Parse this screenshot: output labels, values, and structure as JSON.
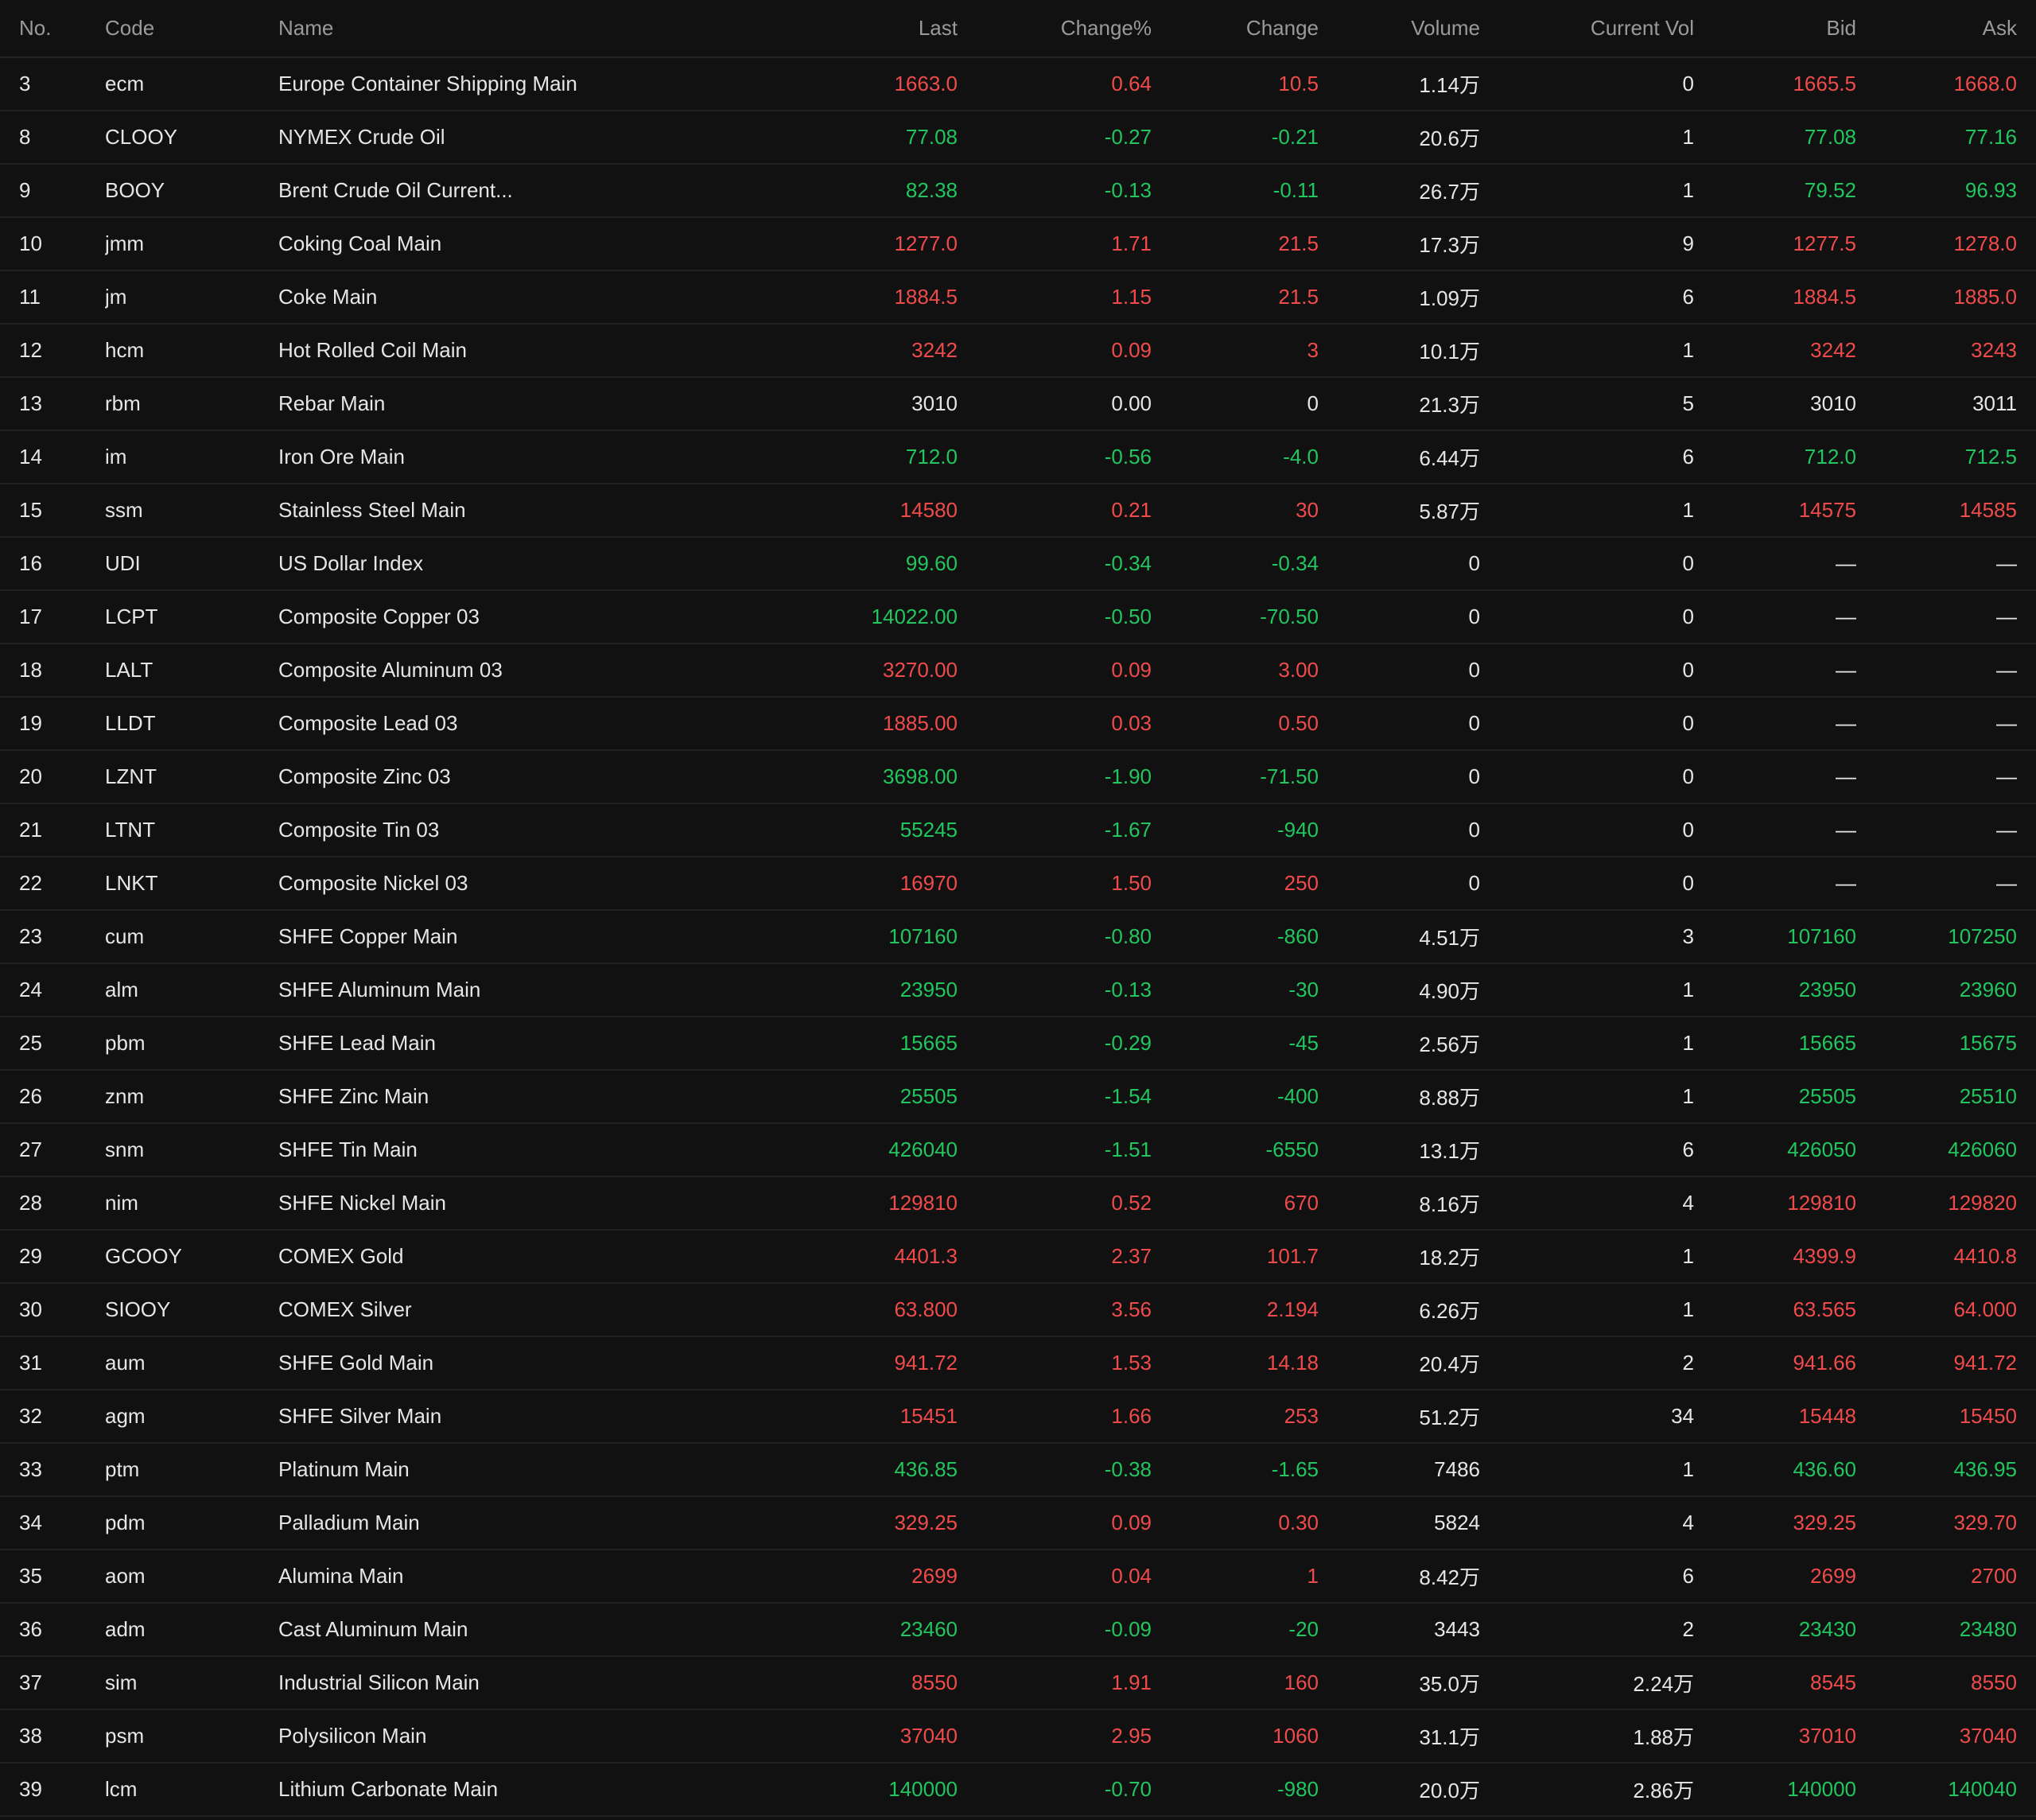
{
  "colors": {
    "background": "#111111",
    "up": "#f04b4b",
    "down": "#22c55e",
    "flat": "#e6e6e6",
    "header_text": "#9a9a9a"
  },
  "table": {
    "headers": {
      "no": "No.",
      "code": "Code",
      "name": "Name",
      "last": "Last",
      "change_pct": "Change%",
      "change": "Change",
      "volume": "Volume",
      "current_vol": "Current Vol",
      "bid": "Bid",
      "ask": "Ask"
    },
    "rows": [
      {
        "no": "3",
        "code": "ecm",
        "name": "Europe Container Shipping Main",
        "last": "1663.0",
        "change_pct": "0.64",
        "change": "10.5",
        "volume": "1.14万",
        "current_vol": "0",
        "bid": "1665.5",
        "ask": "1668.0",
        "dir": "up"
      },
      {
        "no": "8",
        "code": "CLOOY",
        "name": "NYMEX Crude Oil",
        "last": "77.08",
        "change_pct": "-0.27",
        "change": "-0.21",
        "volume": "20.6万",
        "current_vol": "1",
        "bid": "77.08",
        "ask": "77.16",
        "dir": "down"
      },
      {
        "no": "9",
        "code": "BOOY",
        "name": "Brent Crude Oil Current...",
        "last": "82.38",
        "change_pct": "-0.13",
        "change": "-0.11",
        "volume": "26.7万",
        "current_vol": "1",
        "bid": "79.52",
        "ask": "96.93",
        "dir": "down"
      },
      {
        "no": "10",
        "code": "jmm",
        "name": "Coking Coal Main",
        "last": "1277.0",
        "change_pct": "1.71",
        "change": "21.5",
        "volume": "17.3万",
        "current_vol": "9",
        "bid": "1277.5",
        "ask": "1278.0",
        "dir": "up"
      },
      {
        "no": "11",
        "code": "jm",
        "name": "Coke Main",
        "last": "1884.5",
        "change_pct": "1.15",
        "change": "21.5",
        "volume": "1.09万",
        "current_vol": "6",
        "bid": "1884.5",
        "ask": "1885.0",
        "dir": "up"
      },
      {
        "no": "12",
        "code": "hcm",
        "name": "Hot Rolled Coil Main",
        "last": "3242",
        "change_pct": "0.09",
        "change": "3",
        "volume": "10.1万",
        "current_vol": "1",
        "bid": "3242",
        "ask": "3243",
        "dir": "up"
      },
      {
        "no": "13",
        "code": "rbm",
        "name": "Rebar Main",
        "last": "3010",
        "change_pct": "0.00",
        "change": "0",
        "volume": "21.3万",
        "current_vol": "5",
        "bid": "3010",
        "ask": "3011",
        "dir": "flat"
      },
      {
        "no": "14",
        "code": "im",
        "name": "Iron Ore Main",
        "last": "712.0",
        "change_pct": "-0.56",
        "change": "-4.0",
        "volume": "6.44万",
        "current_vol": "6",
        "bid": "712.0",
        "ask": "712.5",
        "dir": "down"
      },
      {
        "no": "15",
        "code": "ssm",
        "name": "Stainless Steel Main",
        "last": "14580",
        "change_pct": "0.21",
        "change": "30",
        "volume": "5.87万",
        "current_vol": "1",
        "bid": "14575",
        "ask": "14585",
        "dir": "up"
      },
      {
        "no": "16",
        "code": "UDI",
        "name": "US Dollar Index",
        "last": "99.60",
        "change_pct": "-0.34",
        "change": "-0.34",
        "volume": "0",
        "current_vol": "0",
        "bid": "—",
        "ask": "—",
        "dir": "down"
      },
      {
        "no": "17",
        "code": "LCPT",
        "name": "Composite Copper 03",
        "last": "14022.00",
        "change_pct": "-0.50",
        "change": "-70.50",
        "volume": "0",
        "current_vol": "0",
        "bid": "—",
        "ask": "—",
        "dir": "down"
      },
      {
        "no": "18",
        "code": "LALT",
        "name": "Composite Aluminum 03",
        "last": "3270.00",
        "change_pct": "0.09",
        "change": "3.00",
        "volume": "0",
        "current_vol": "0",
        "bid": "—",
        "ask": "—",
        "dir": "up"
      },
      {
        "no": "19",
        "code": "LLDT",
        "name": "Composite Lead 03",
        "last": "1885.00",
        "change_pct": "0.03",
        "change": "0.50",
        "volume": "0",
        "current_vol": "0",
        "bid": "—",
        "ask": "—",
        "dir": "up"
      },
      {
        "no": "20",
        "code": "LZNT",
        "name": "Composite Zinc 03",
        "last": "3698.00",
        "change_pct": "-1.90",
        "change": "-71.50",
        "volume": "0",
        "current_vol": "0",
        "bid": "—",
        "ask": "—",
        "dir": "down"
      },
      {
        "no": "21",
        "code": "LTNT",
        "name": "Composite Tin 03",
        "last": "55245",
        "change_pct": "-1.67",
        "change": "-940",
        "volume": "0",
        "current_vol": "0",
        "bid": "—",
        "ask": "—",
        "dir": "down"
      },
      {
        "no": "22",
        "code": "LNKT",
        "name": "Composite Nickel 03",
        "last": "16970",
        "change_pct": "1.50",
        "change": "250",
        "volume": "0",
        "current_vol": "0",
        "bid": "—",
        "ask": "—",
        "dir": "up"
      },
      {
        "no": "23",
        "code": "cum",
        "name": "SHFE Copper Main",
        "last": "107160",
        "change_pct": "-0.80",
        "change": "-860",
        "volume": "4.51万",
        "current_vol": "3",
        "bid": "107160",
        "ask": "107250",
        "dir": "down"
      },
      {
        "no": "24",
        "code": "alm",
        "name": "SHFE Aluminum Main",
        "last": "23950",
        "change_pct": "-0.13",
        "change": "-30",
        "volume": "4.90万",
        "current_vol": "1",
        "bid": "23950",
        "ask": "23960",
        "dir": "down"
      },
      {
        "no": "25",
        "code": "pbm",
        "name": "SHFE Lead Main",
        "last": "15665",
        "change_pct": "-0.29",
        "change": "-45",
        "volume": "2.56万",
        "current_vol": "1",
        "bid": "15665",
        "ask": "15675",
        "dir": "down"
      },
      {
        "no": "26",
        "code": "znm",
        "name": "SHFE Zinc Main",
        "last": "25505",
        "change_pct": "-1.54",
        "change": "-400",
        "volume": "8.88万",
        "current_vol": "1",
        "bid": "25505",
        "ask": "25510",
        "dir": "down"
      },
      {
        "no": "27",
        "code": "snm",
        "name": "SHFE Tin Main",
        "last": "426040",
        "change_pct": "-1.51",
        "change": "-6550",
        "volume": "13.1万",
        "current_vol": "6",
        "bid": "426050",
        "ask": "426060",
        "dir": "down"
      },
      {
        "no": "28",
        "code": "nim",
        "name": "SHFE Nickel Main",
        "last": "129810",
        "change_pct": "0.52",
        "change": "670",
        "volume": "8.16万",
        "current_vol": "4",
        "bid": "129810",
        "ask": "129820",
        "dir": "up"
      },
      {
        "no": "29",
        "code": "GCOOY",
        "name": "COMEX Gold",
        "last": "4401.3",
        "change_pct": "2.37",
        "change": "101.7",
        "volume": "18.2万",
        "current_vol": "1",
        "bid": "4399.9",
        "ask": "4410.8",
        "dir": "up"
      },
      {
        "no": "30",
        "code": "SIOOY",
        "name": "COMEX Silver",
        "last": "63.800",
        "change_pct": "3.56",
        "change": "2.194",
        "volume": "6.26万",
        "current_vol": "1",
        "bid": "63.565",
        "ask": "64.000",
        "dir": "up"
      },
      {
        "no": "31",
        "code": "aum",
        "name": "SHFE Gold Main",
        "last": "941.72",
        "change_pct": "1.53",
        "change": "14.18",
        "volume": "20.4万",
        "current_vol": "2",
        "bid": "941.66",
        "ask": "941.72",
        "dir": "up"
      },
      {
        "no": "32",
        "code": "agm",
        "name": "SHFE Silver Main",
        "last": "15451",
        "change_pct": "1.66",
        "change": "253",
        "volume": "51.2万",
        "current_vol": "34",
        "bid": "15448",
        "ask": "15450",
        "dir": "up"
      },
      {
        "no": "33",
        "code": "ptm",
        "name": "Platinum Main",
        "last": "436.85",
        "change_pct": "-0.38",
        "change": "-1.65",
        "volume": "7486",
        "current_vol": "1",
        "bid": "436.60",
        "ask": "436.95",
        "dir": "down"
      },
      {
        "no": "34",
        "code": "pdm",
        "name": "Palladium Main",
        "last": "329.25",
        "change_pct": "0.09",
        "change": "0.30",
        "volume": "5824",
        "current_vol": "4",
        "bid": "329.25",
        "ask": "329.70",
        "dir": "up"
      },
      {
        "no": "35",
        "code": "aom",
        "name": "Alumina Main",
        "last": "2699",
        "change_pct": "0.04",
        "change": "1",
        "volume": "8.42万",
        "current_vol": "6",
        "bid": "2699",
        "ask": "2700",
        "dir": "up"
      },
      {
        "no": "36",
        "code": "adm",
        "name": "Cast Aluminum Main",
        "last": "23460",
        "change_pct": "-0.09",
        "change": "-20",
        "volume": "3443",
        "current_vol": "2",
        "bid": "23430",
        "ask": "23480",
        "dir": "down"
      },
      {
        "no": "37",
        "code": "sim",
        "name": "Industrial Silicon Main",
        "last": "8550",
        "change_pct": "1.91",
        "change": "160",
        "volume": "35.0万",
        "current_vol": "2.24万",
        "bid": "8545",
        "ask": "8550",
        "dir": "up"
      },
      {
        "no": "38",
        "code": "psm",
        "name": "Polysilicon Main",
        "last": "37040",
        "change_pct": "2.95",
        "change": "1060",
        "volume": "31.1万",
        "current_vol": "1.88万",
        "bid": "37010",
        "ask": "37040",
        "dir": "up"
      },
      {
        "no": "39",
        "code": "lcm",
        "name": "Lithium Carbonate Main",
        "last": "140000",
        "change_pct": "-0.70",
        "change": "-980",
        "volume": "20.0万",
        "current_vol": "2.86万",
        "bid": "140000",
        "ask": "140040",
        "dir": "down"
      }
    ]
  }
}
